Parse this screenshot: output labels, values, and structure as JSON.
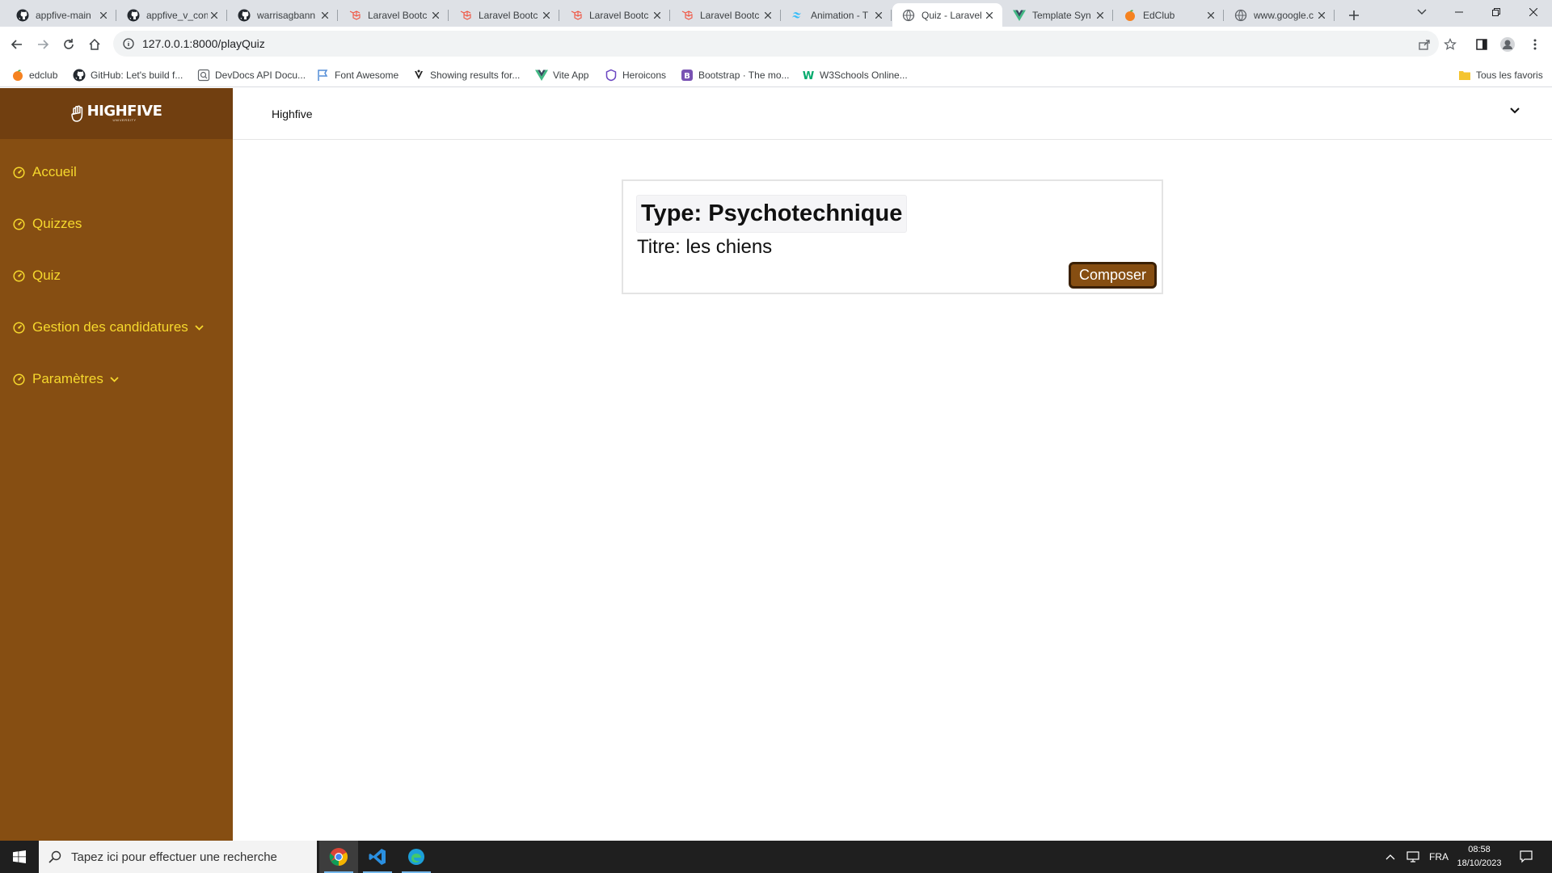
{
  "browser": {
    "tabs": [
      {
        "title": "appfive-main",
        "icon": "github-icon"
      },
      {
        "title": "appfive_v_con",
        "icon": "github-icon"
      },
      {
        "title": "warrisagbann",
        "icon": "github-icon"
      },
      {
        "title": "Laravel Bootc",
        "icon": "laravel-icon"
      },
      {
        "title": "Laravel Bootc",
        "icon": "laravel-icon"
      },
      {
        "title": "Laravel Bootc",
        "icon": "laravel-icon"
      },
      {
        "title": "Laravel Bootc",
        "icon": "laravel-icon"
      },
      {
        "title": "Animation - T",
        "icon": "tailwind-icon"
      },
      {
        "title": "Quiz - Laravel",
        "icon": "globe-icon",
        "active": true
      },
      {
        "title": "Template Syn",
        "icon": "vue-icon"
      },
      {
        "title": "EdClub",
        "icon": "edclub-icon"
      },
      {
        "title": "www.google.c",
        "icon": "globe-icon"
      }
    ],
    "url": "127.0.0.1:8000/playQuiz",
    "bookmarks": [
      {
        "label": "edclub",
        "icon": "edclub-icon"
      },
      {
        "label": "GitHub: Let's build f...",
        "icon": "github-icon"
      },
      {
        "label": "DevDocs API Docu...",
        "icon": "devdocs-icon"
      },
      {
        "label": "Font Awesome",
        "icon": "flag-icon"
      },
      {
        "label": "Showing results for...",
        "icon": "search-results-icon"
      },
      {
        "label": "Vite App",
        "icon": "vue-icon"
      },
      {
        "label": "Heroicons",
        "icon": "heroicons-icon"
      },
      {
        "label": "Bootstrap · The mo...",
        "icon": "bootstrap-icon"
      },
      {
        "label": "W3Schools Online...",
        "icon": "w3schools-icon"
      }
    ],
    "all_bookmarks": "Tous les favoris"
  },
  "app": {
    "logo_text": "HIGHFIVE",
    "logo_subtext": "UNIVERSITY",
    "brand": "Highfive",
    "nav": [
      {
        "label": "Accueil",
        "dropdown": false
      },
      {
        "label": "Quizzes",
        "dropdown": false
      },
      {
        "label": "Quiz",
        "dropdown": false
      },
      {
        "label": "Gestion des candidatures",
        "dropdown": true
      },
      {
        "label": "Paramètres",
        "dropdown": true
      }
    ],
    "quiz_card": {
      "type": "Type: Psychotechnique",
      "title": "Titre: les chiens",
      "button": "Composer"
    },
    "colors": {
      "sidebar": "#864e12",
      "logo_bar": "#713f10",
      "nav_text": "#f6d82d",
      "button": "#864e12"
    }
  },
  "taskbar": {
    "search_placeholder": "Tapez ici pour effectuer une recherche",
    "apps": [
      "chrome-icon",
      "vscode-icon",
      "edge-icon"
    ],
    "language": "FRA",
    "time": "08:58",
    "date": "18/10/2023"
  }
}
